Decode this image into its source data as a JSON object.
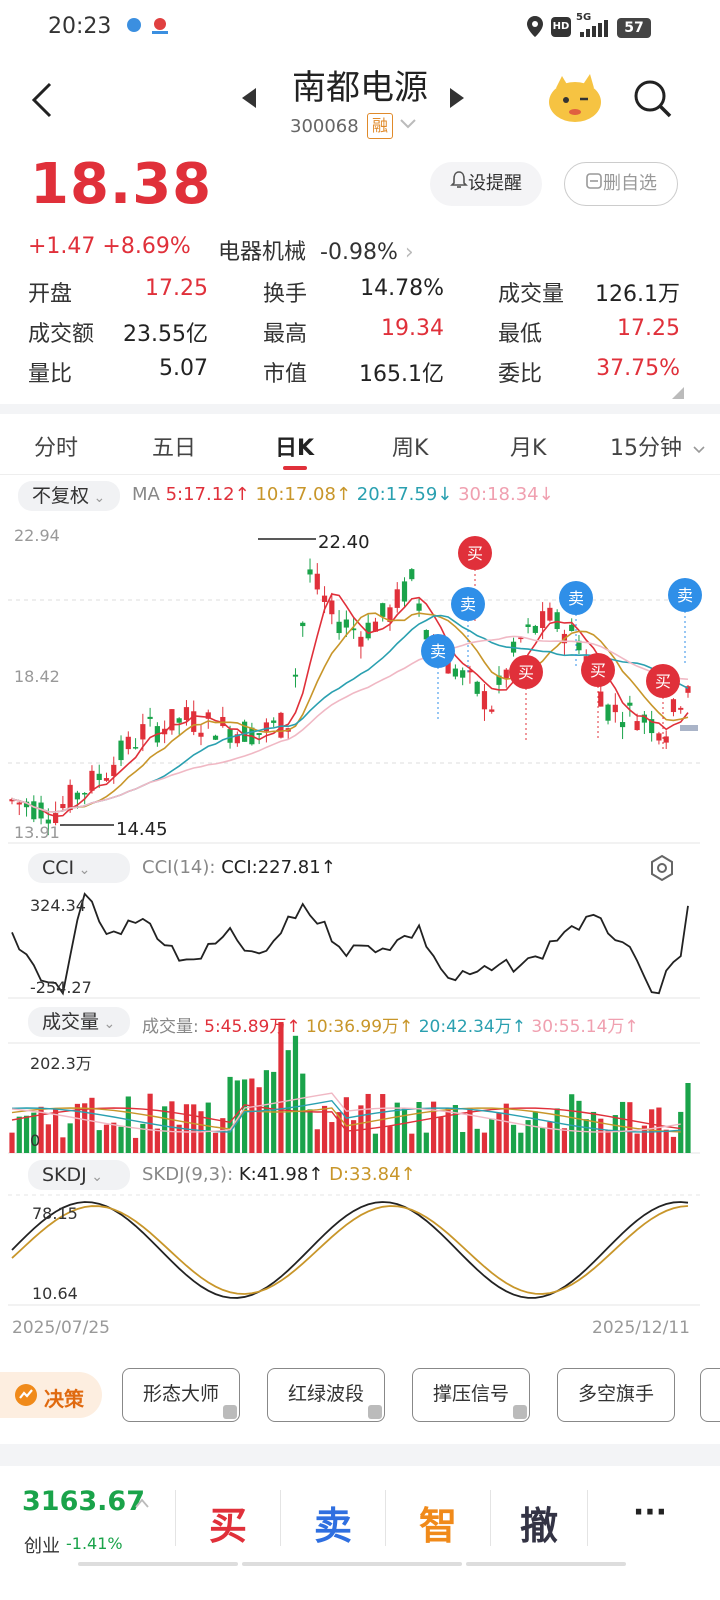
{
  "status_bar": {
    "time": "20:23",
    "battery": "57",
    "network": "5G",
    "hd": "HD"
  },
  "header": {
    "title": "南都电源",
    "code": "300068",
    "margin_badge": "融"
  },
  "quote": {
    "price": "18.38",
    "change": "+1.47",
    "change_pct": "+8.69%",
    "sector": "电器机械",
    "sector_pct": "-0.98%",
    "alert_button": "设提醒",
    "remove_button": "删自选"
  },
  "stats": [
    {
      "label": "开盘",
      "value": "17.25",
      "color": "red"
    },
    {
      "label": "换手",
      "value": "14.78%",
      "color": "dark"
    },
    {
      "label": "成交量",
      "value": "126.1万",
      "color": "dark"
    },
    {
      "label": "成交额",
      "value": "23.55亿",
      "color": "dark"
    },
    {
      "label": "最高",
      "value": "19.34",
      "color": "red"
    },
    {
      "label": "最低",
      "value": "17.25",
      "color": "red"
    },
    {
      "label": "量比",
      "value": "5.07",
      "color": "dark"
    },
    {
      "label": "市值",
      "value": "165.1亿",
      "color": "dark"
    },
    {
      "label": "委比",
      "value": "37.75%",
      "color": "red"
    }
  ],
  "tabs": [
    "分时",
    "五日",
    "日K",
    "周K",
    "月K",
    "15分钟"
  ],
  "active_tab": "日K",
  "kline": {
    "adjust": "不复权",
    "ma_label": "MA",
    "ma5": "5:17.12↑",
    "ma10": "10:17.08↑",
    "ma20": "20:17.59↓",
    "ma30": "30:18.34↓",
    "y_top": "22.94",
    "y_mid": "18.42",
    "y_bottom": "13.91",
    "high_mark": "22.40",
    "low_mark": "14.45",
    "buy_label": "买",
    "sell_label": "卖"
  },
  "cci": {
    "selector": "CCI",
    "name": "CCI(14):",
    "value": "CCI:227.81↑",
    "top": "324.34",
    "bottom": "-254.27"
  },
  "volume": {
    "selector": "成交量",
    "name": "成交量:",
    "v5": "5:45.89万↑",
    "v10": "10:36.99万↑",
    "v20": "20:42.34万↑",
    "v30": "30:55.14万↑",
    "top": "202.3万",
    "zero": "0"
  },
  "skdj": {
    "selector": "SKDJ",
    "name": "SKDJ(9,3):",
    "k": "K:41.98↑",
    "d": "D:33.84↑",
    "top": "78.15",
    "bottom": "10.64",
    "date_start": "2025/07/25",
    "date_end": "2025/12/11"
  },
  "strategy": {
    "label": "决策",
    "buttons": [
      "形态大师",
      "红绿波段",
      "撑压信号",
      "多空旗手"
    ]
  },
  "bottom_bar": {
    "index_value": "3163.67",
    "index_name": "创业",
    "index_pct": "-1.41%",
    "buy": "买",
    "sell": "卖",
    "smart": "智",
    "cancel": "撤",
    "more": "···"
  },
  "colors": {
    "up": "#e0303a",
    "down": "#1aa34a",
    "ma5": "#e0303a",
    "ma10": "#c8962a",
    "ma20": "#2aa0b0",
    "ma30": "#f0a0b0",
    "blue_tag": "#2f8fe8"
  }
}
